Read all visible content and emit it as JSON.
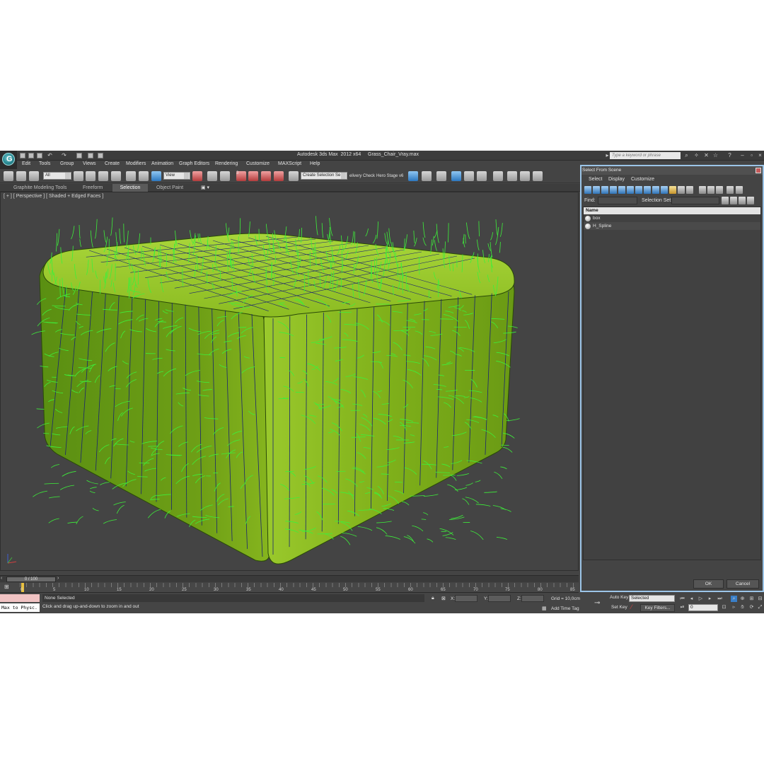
{
  "app": {
    "title": "Autodesk 3ds Max  2012 x64     Grass_Chair_Vray.max",
    "search_placeholder": "Type a keyword or phrase",
    "logo_letter": "G"
  },
  "menu": [
    "Edit",
    "Tools",
    "Group",
    "Views",
    "Create",
    "Modifiers",
    "Animation",
    "Graph Editors",
    "Rendering",
    "Customize",
    "MAXScript",
    "Help"
  ],
  "toolbar": {
    "filter_value": "All",
    "refcoord_value": "View",
    "snap_label": "3",
    "named_selection": "Create Selection Se",
    "delivery_label": "elivery Check",
    "hero_label": "Hero Stage v6"
  },
  "ribbon": {
    "tabs": [
      "Graphite Modeling Tools",
      "Freeform",
      "Selection",
      "Object Paint"
    ],
    "active": "Selection"
  },
  "viewport": {
    "label": "[ + ] [ Perspective ] [ Shaded + Edged Faces ]",
    "grass_color": "#3df03a",
    "base_color": "#6aa818",
    "wire_color": "#1b2470"
  },
  "timeline": {
    "frame": "0 / 100",
    "ticks": [
      "0",
      "5",
      "10",
      "15",
      "20",
      "25",
      "30",
      "35",
      "40",
      "45",
      "50",
      "55",
      "60",
      "65",
      "70",
      "75",
      "80",
      "85"
    ]
  },
  "status": {
    "maxscript_text": "Max to Physc.",
    "selection": "None Selected",
    "prompt": "Click and drag up-and-down to zoom in and out",
    "x_label": "X:",
    "y_label": "Y:",
    "z_label": "Z:",
    "grid": "Grid = 10,0cm",
    "add_time_tag": "Add Time Tag",
    "auto_key": "Auto Key",
    "set_key": "Set Key",
    "selected_value": "Selected",
    "key_filters": "Key Filters...",
    "current_frame": "0"
  },
  "dialog": {
    "title": "Select From Scene",
    "menu": [
      "Select",
      "Display",
      "Customize"
    ],
    "find_label": "Find:",
    "selection_set_label": "Selection Set:",
    "column_name": "Name",
    "objects": [
      "box",
      "H_Spline"
    ],
    "ok": "OK",
    "cancel": "Cancel"
  }
}
